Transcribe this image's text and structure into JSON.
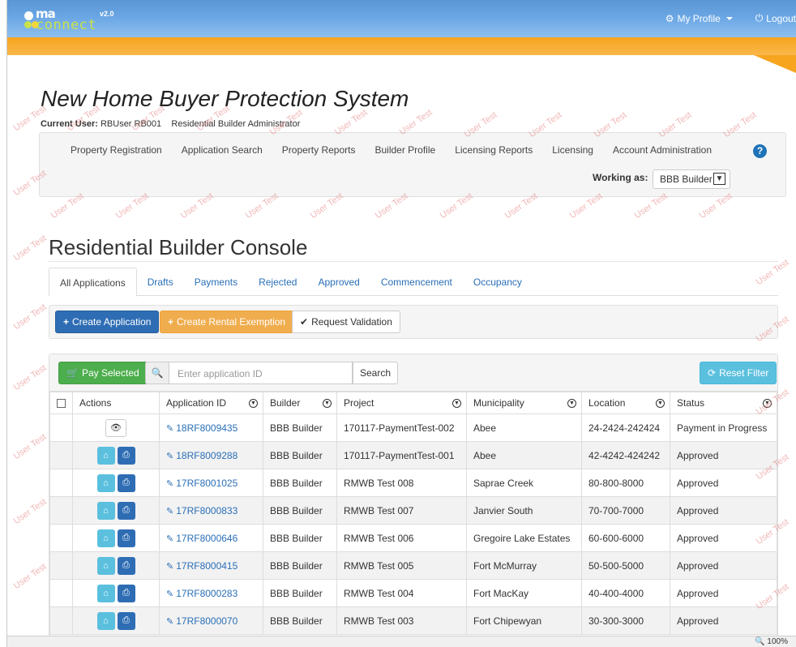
{
  "app": {
    "logo_ma": "ma",
    "logo_connect": "connect",
    "logo_version": "v2.0",
    "profile_label": "My Profile",
    "logout_label": "Logout"
  },
  "header": {
    "system_title": "New Home Buyer Protection System",
    "current_user_label": "Current User:",
    "current_user_value": "RBUser RB001",
    "current_role": "Residential Builder Administrator"
  },
  "nav": {
    "items": [
      "Property Registration",
      "Application Search",
      "Property Reports",
      "Builder Profile",
      "Licensing Reports",
      "Licensing",
      "Account Administration"
    ],
    "help_symbol": "?",
    "working_as_label": "Working as:",
    "working_as_value": "BBB Builder"
  },
  "watermark_text": "User Test",
  "console": {
    "title": "Residential Builder Console",
    "tabs": [
      "All Applications",
      "Drafts",
      "Payments",
      "Rejected",
      "Approved",
      "Commencement",
      "Occupancy"
    ],
    "active_tab": "All Applications",
    "create_application": "Create Application",
    "create_rental_exemption": "Create Rental Exemption",
    "request_validation": "Request Validation"
  },
  "table_toolbar": {
    "pay_selected": "Pay Selected",
    "search_placeholder": "Enter application ID",
    "search_button": "Search",
    "reset_filter": "Reset Filter"
  },
  "table": {
    "columns": [
      "Actions",
      "Application ID",
      "Builder",
      "Project",
      "Municipality",
      "Location",
      "Status"
    ],
    "rows": [
      {
        "id": "18RF8009435",
        "builder": "BBB Builder",
        "project": "170117-PaymentTest-002",
        "municipality": "Abee",
        "location": "24-2424-242424",
        "status": "Payment in Progress",
        "actions": "view"
      },
      {
        "id": "18RF8009288",
        "builder": "BBB Builder",
        "project": "170117-PaymentTest-001",
        "municipality": "Abee",
        "location": "42-4242-424242",
        "status": "Approved",
        "actions": "home-print"
      },
      {
        "id": "17RF8001025",
        "builder": "BBB Builder",
        "project": "RMWB Test 008",
        "municipality": "Saprae Creek",
        "location": "80-800-8000",
        "status": "Approved",
        "actions": "home-print"
      },
      {
        "id": "17RF8000833",
        "builder": "BBB Builder",
        "project": "RMWB Test 007",
        "municipality": "Janvier South",
        "location": "70-700-7000",
        "status": "Approved",
        "actions": "home-print"
      },
      {
        "id": "17RF8000646",
        "builder": "BBB Builder",
        "project": "RMWB Test 006",
        "municipality": "Gregoire Lake Estates",
        "location": "60-600-6000",
        "status": "Approved",
        "actions": "home-print"
      },
      {
        "id": "17RF8000415",
        "builder": "BBB Builder",
        "project": "RMWB Test 005",
        "municipality": "Fort McMurray",
        "location": "50-500-5000",
        "status": "Approved",
        "actions": "home-print"
      },
      {
        "id": "17RF8000283",
        "builder": "BBB Builder",
        "project": "RMWB Test 004",
        "municipality": "Fort MacKay",
        "location": "40-400-4000",
        "status": "Approved",
        "actions": "home-print"
      },
      {
        "id": "17RF8000070",
        "builder": "BBB Builder",
        "project": "RMWB Test 003",
        "municipality": "Fort Chipewyan",
        "location": "30-300-3000",
        "status": "Approved",
        "actions": "home-print"
      }
    ]
  },
  "statusbar": {
    "zoom": "100%"
  },
  "colors": {
    "topbar": "#6aa6e4",
    "orange": "#f7a41e",
    "link": "#2a6fb6",
    "primary": "#2e6db4",
    "warning": "#f0ad4e",
    "success": "#4cae4c",
    "info": "#5bc0de"
  }
}
